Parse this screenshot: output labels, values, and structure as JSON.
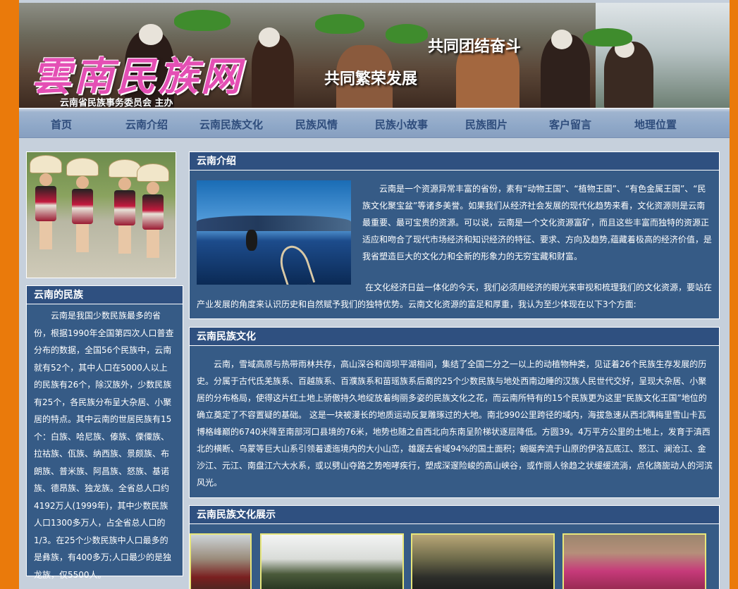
{
  "banner": {
    "logo_text": "雲南民族网",
    "sponsor": "云南省民族事务委员会 主办",
    "slogan_top": "共同团结奋斗",
    "slogan_bottom": "共同繁荣发展"
  },
  "nav": {
    "items": [
      "首页",
      "云南介绍",
      "云南民族文化",
      "民族风情",
      "民族小故事",
      "民族图片",
      "客户留言",
      "地理位置"
    ]
  },
  "nations": {
    "title": "云南的民族",
    "text": "云南是我国少数民族最多的省份，根据1990年全国第四次人口普查分布的数据，全国56个民族中，云南就有52个，其中人口在5000人以上的民族有26个，除汉族外，少数民族有25个，各民族分布呈大杂居、小聚居的特点。其中云南的世居民族有15个：白族、哈尼族、傣族、傈僳族、拉祜族、佤族、纳西族、景颇族、布朗族、普米族、阿昌族、怒族、基诺族、德昂族、独龙族。全省总人口约4192万人(1999年)，其中少数民族人口1300多万人，占全省总人口的1/3。在25个少数民族中人口最多的是彝族，有400多万;人口最少的是独龙族，仅5500人。"
  },
  "intro": {
    "title": "云南介绍",
    "p1": "云南是一个资源异常丰富的省份，素有“动物王国”、“植物王国”、“有色金属王国”、“民族文化聚宝盆”等诸多美誉。如果我们从经济社会发展的现代化趋势来看，文化资源则是云南最重要、最可宝贵的资源。可以说，云南是一个文化资源富矿，而且这些丰富而独特的资源正适应和吻合了现代市场经济和知识经济的特征、要求、方向及趋势,蕴藏着极高的经济价值，是我省塑造巨大的文化力和全新的形象力的无穷宝藏和财富。",
    "p2": "在文化经济日益一体化的今天，我们必须用经济的眼光来审视和梳理我们的文化资源，要站在产业发展的角度来认识历史和自然赋予我们的独特优势。云南文化资源的富足和厚重，我认为至少体现在以下3个方面:"
  },
  "culture": {
    "title": "云南民族文化",
    "text": "云南，雪域高原与热带雨林共存，高山深谷和阔坝平湖相间，集结了全国二分之一以上的动植物种类，见证着26个民族生存发展的历史。分属于古代氐羌族系、百越族系、百濮族系和苗瑶族系后裔的25个少数民族与地处西南边睡的汉族人民世代交好，呈现大杂居、小聚居的分布格局，使得这片红土地上骄傲持久地绽放着绚丽多姿的民族文化之花，而云南所特有的15个民族更为这里“民族文化王国”地位的确立奠定了不容置疑的基础。 这是一块被漫长的地质运动反复雕琢过的大地。南北990公里跨径的域内，海拔急速从西北隅梅里雪山卡瓦博格峰巅的6740米降至南部河口县境的76米，地势也随之自西北向东南呈阶梯状逐层降低。方圆39。4万平方公里的土地上，发育于滇西北的横断、乌蒙等巨大山系引领着逶迤境内的大小山峦，雄踞去省域94%的国土面积；蜿蜒奔流于山原的伊洛瓦底江、怒江、澜沧江、金沙江、元江、南盘江六大水系，或以劈山夺路之势咆哮疾行，塑成深邃险峻的高山峡谷，或作丽人徐趋之状缓缓流淌，点化旖旎动人的河滨风光。"
  },
  "gallery": {
    "title": "云南民族文化展示"
  },
  "colors": {
    "frame": "#ea7a0b",
    "page_bg": "#c6d0dc",
    "panel": "#365b86",
    "nav_text": "#2f4d7c",
    "logo": "#e44fb4"
  }
}
